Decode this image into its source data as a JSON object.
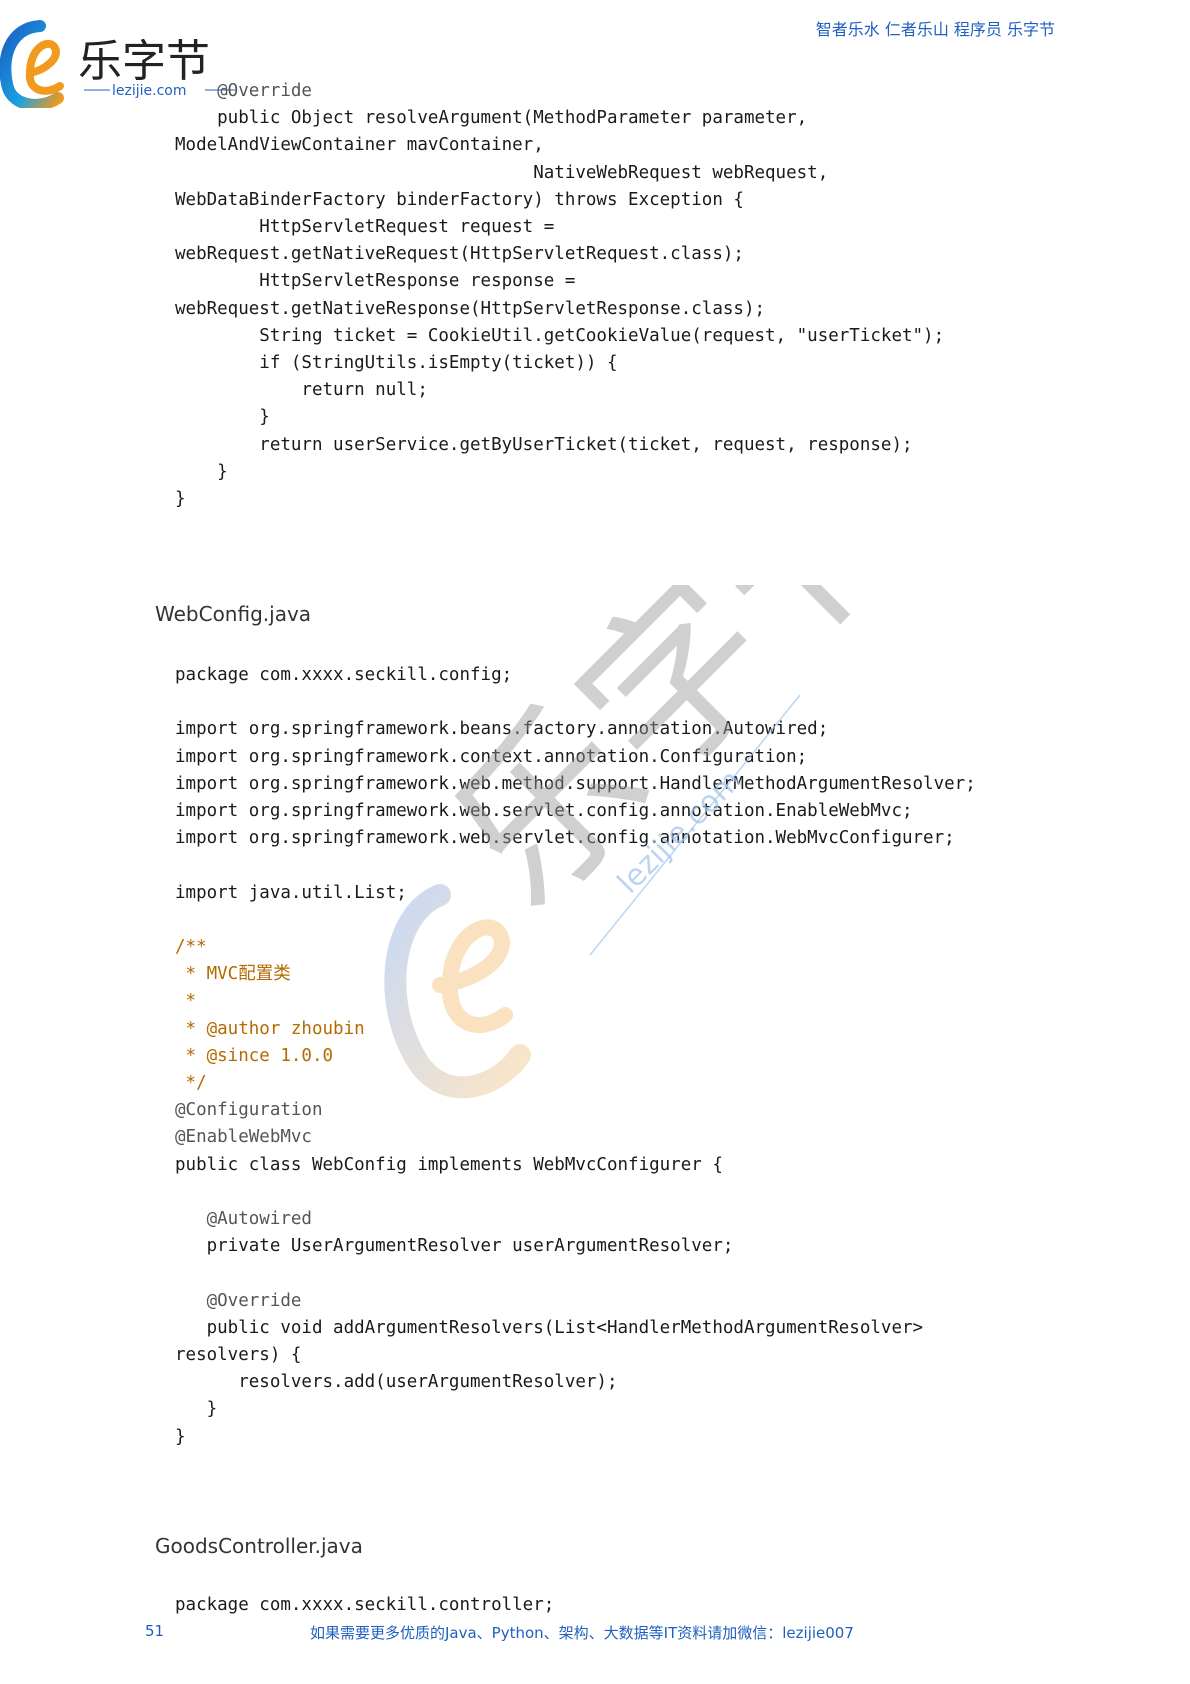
{
  "header": {
    "logo_text": "乐字节",
    "logo_url": "lezijie.com",
    "slogan": "智者乐水 仁者乐山 程序员 乐字节"
  },
  "blocks": [
    {
      "lines": [
        "    @Override",
        "    public Object resolveArgument(MethodParameter parameter,",
        "ModelAndViewContainer mavContainer,",
        "                                  NativeWebRequest webRequest,",
        "WebDataBinderFactory binderFactory) throws Exception {",
        "        HttpServletRequest request =",
        "webRequest.getNativeRequest(HttpServletRequest.class);",
        "        HttpServletResponse response =",
        "webRequest.getNativeResponse(HttpServletResponse.class);",
        "        String ticket = CookieUtil.getCookieValue(request, \"userTicket\");",
        "        if (StringUtils.isEmpty(ticket)) {",
        "            return null;",
        "        }",
        "        return userService.getByUserTicket(ticket, request, response);",
        "    }",
        "}"
      ]
    },
    {
      "filename": "WebConfig.java",
      "lines": [
        "package com.xxxx.seckill.config;",
        "",
        "import org.springframework.beans.factory.annotation.Autowired;",
        "import org.springframework.context.annotation.Configuration;",
        "import org.springframework.web.method.support.HandlerMethodArgumentResolver;",
        "import org.springframework.web.servlet.config.annotation.EnableWebMvc;",
        "import org.springframework.web.servlet.config.annotation.WebMvcConfigurer;",
        "",
        "import java.util.List;",
        "",
        "/**",
        " * MVC配置类",
        " *",
        " * @author zhoubin",
        " * @since 1.0.0",
        " */",
        "@Configuration",
        "@EnableWebMvc",
        "public class WebConfig implements WebMvcConfigurer {",
        "",
        "   @Autowired",
        "   private UserArgumentResolver userArgumentResolver;",
        "",
        "   @Override",
        "   public void addArgumentResolvers(List<HandlerMethodArgumentResolver>",
        "resolvers) {",
        "      resolvers.add(userArgumentResolver);",
        "   }",
        "}"
      ]
    },
    {
      "filename": "GoodsController.java",
      "lines": [
        "package com.xxxx.seckill.controller;"
      ]
    }
  ],
  "footer": {
    "page_number": "51",
    "note": "如果需要更多优质的Java、Python、架构、大数据等IT资料请加微信：lezijie007"
  },
  "watermark": {
    "text": "乐字节",
    "url": "lezijie.com"
  }
}
